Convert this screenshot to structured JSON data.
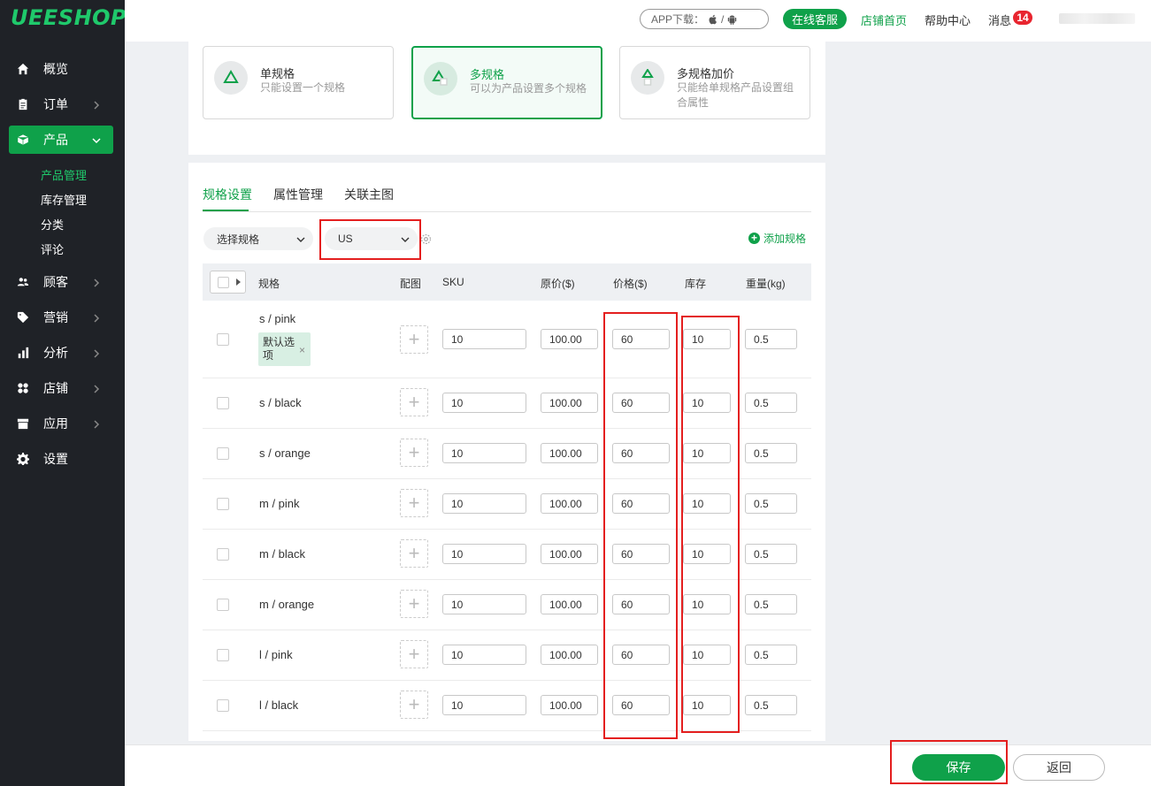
{
  "logo": "UEESHOP",
  "header": {
    "app_download": "APP下载：",
    "app_sep": "/",
    "online_service": "在线客服",
    "store_home": "店铺首页",
    "help_center": "帮助中心",
    "messages": "消息",
    "message_count": "14"
  },
  "sidebar": {
    "items": [
      {
        "label": "概览",
        "icon": "home-icon"
      },
      {
        "label": "订单",
        "icon": "clipboard-icon"
      },
      {
        "label": "产品",
        "icon": "cube-icon"
      },
      {
        "label": "顾客",
        "icon": "users-icon"
      },
      {
        "label": "营销",
        "icon": "tag-icon"
      },
      {
        "label": "分析",
        "icon": "bar-chart-icon"
      },
      {
        "label": "店铺",
        "icon": "grid-icon"
      },
      {
        "label": "应用",
        "icon": "apps-icon"
      },
      {
        "label": "设置",
        "icon": "gear-icon"
      }
    ],
    "sub_items": [
      "产品管理",
      "库存管理",
      "分类",
      "评论"
    ]
  },
  "spec_types": [
    {
      "title": "单规格",
      "desc": "只能设置一个规格"
    },
    {
      "title": "多规格",
      "desc": "可以为产品设置多个规格"
    },
    {
      "title": "多规格加价",
      "desc": "只能给单规格产品设置组合属性"
    }
  ],
  "tabs": [
    "规格设置",
    "属性管理",
    "关联主图"
  ],
  "controls": {
    "select_spec": "选择规格",
    "region": "US",
    "add_spec": "添加规格"
  },
  "table": {
    "headers": [
      "规格",
      "配图",
      "SKU",
      "原价($)",
      "价格($)",
      "库存",
      "重量(kg)"
    ],
    "default_tag": "默认选项",
    "rows": [
      {
        "spec": "s / pink",
        "sku": "10",
        "orig_price": "100.00",
        "price": "60",
        "stock": "10",
        "weight": "0.5"
      },
      {
        "spec": "s / black",
        "sku": "10",
        "orig_price": "100.00",
        "price": "60",
        "stock": "10",
        "weight": "0.5"
      },
      {
        "spec": "s / orange",
        "sku": "10",
        "orig_price": "100.00",
        "price": "60",
        "stock": "10",
        "weight": "0.5"
      },
      {
        "spec": "m / pink",
        "sku": "10",
        "orig_price": "100.00",
        "price": "60",
        "stock": "10",
        "weight": "0.5"
      },
      {
        "spec": "m / black",
        "sku": "10",
        "orig_price": "100.00",
        "price": "60",
        "stock": "10",
        "weight": "0.5"
      },
      {
        "spec": "m / orange",
        "sku": "10",
        "orig_price": "100.00",
        "price": "60",
        "stock": "10",
        "weight": "0.5"
      },
      {
        "spec": "l / pink",
        "sku": "10",
        "orig_price": "100.00",
        "price": "60",
        "stock": "10",
        "weight": "0.5"
      },
      {
        "spec": "l / black",
        "sku": "10",
        "orig_price": "100.00",
        "price": "60",
        "stock": "10",
        "weight": "0.5"
      }
    ]
  },
  "footer": {
    "save": "保存",
    "back": "返回"
  },
  "colors": {
    "brand": "#0fa14a",
    "sidebar_bg": "#1f2227",
    "badge": "#e8252f",
    "annotation": "#e41f1f"
  }
}
